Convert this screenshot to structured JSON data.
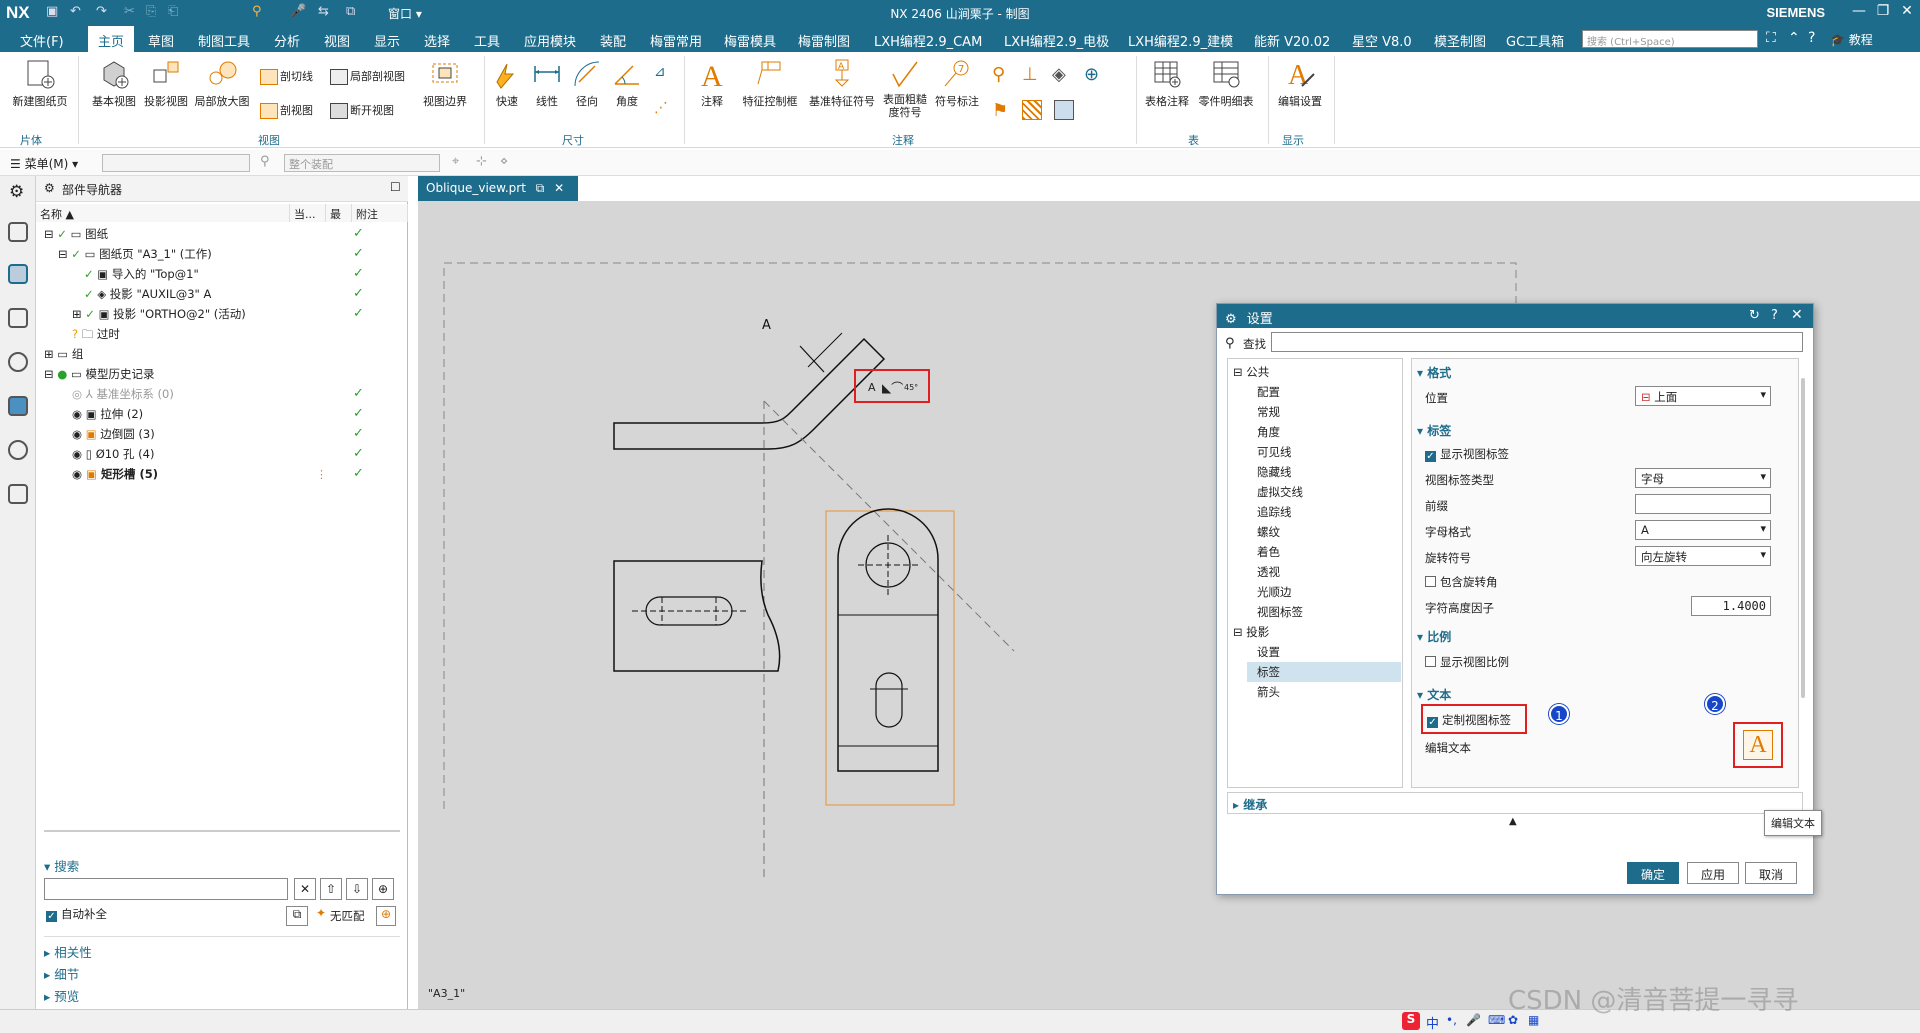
{
  "titlebar": {
    "logo": "NX",
    "title": "NX 2406 山涧栗子 - 制图",
    "window_menu": "窗口",
    "brand": "SIEMENS"
  },
  "menubar": {
    "items": [
      "文件(F)",
      "主页",
      "草图",
      "制图工具",
      "分析",
      "视图",
      "显示",
      "选择",
      "工具",
      "应用模块",
      "装配",
      "梅雷常用",
      "梅雷模具",
      "梅雷制图",
      "LXH编程2.9_CAM",
      "LXH编程2.9_电极",
      "LXH编程2.9_建模",
      "能新 V20.02",
      "星空 V8.0",
      "模圣制图",
      "GC工具箱"
    ],
    "search_placeholder": "搜索 (Ctrl+Space)",
    "tutorial": "教程"
  },
  "ribbon": {
    "sheet_group": {
      "new_sheet": "新建图纸页",
      "label": "片体"
    },
    "view_group": {
      "base_view": "基本视图",
      "projected_view": "投影视图",
      "detail_view": "局部放大图",
      "section_line": "剖切线",
      "section_view": "剖视图",
      "local_section": "局部剖视图",
      "break_view": "断开视图",
      "view_boundary": "视图边界",
      "label": "视图"
    },
    "dim_group": {
      "rapid": "快速",
      "linear": "线性",
      "radial": "径向",
      "angular": "角度",
      "label": "尺寸"
    },
    "annot_group": {
      "note": "注释",
      "fcf": "特征控制框",
      "datum": "基准特征符号",
      "surface_finish": "表面粗糙度符号",
      "symbol_label": "符号标注",
      "label": "注释"
    },
    "table_group": {
      "tabular_note": "表格注释",
      "parts_list": "零件明细表",
      "label": "表"
    },
    "display_group": {
      "edit_settings": "编辑设置",
      "label": "显示"
    }
  },
  "toolbar2": {
    "menu": "菜单(M)",
    "assembly_filter": "整个装配"
  },
  "navigator": {
    "title": "部件导航器",
    "columns": [
      "名称",
      "当...",
      "最",
      "附注"
    ],
    "rows": [
      {
        "label": "图纸",
        "indent": 0
      },
      {
        "label": "图纸页 \"A3_1\" (工作)",
        "indent": 1
      },
      {
        "label": "导入的 \"Top@1\"",
        "indent": 2
      },
      {
        "label": "投影 \"AUXIL@3\" A",
        "indent": 2
      },
      {
        "label": "投影 \"ORTHO@2\" (活动)",
        "indent": 2
      },
      {
        "label": "过时",
        "indent": 1
      },
      {
        "label": "组",
        "indent": 0
      },
      {
        "label": "模型历史记录",
        "indent": 0
      },
      {
        "label": "基准坐标系 (0)",
        "indent": 1
      },
      {
        "label": "拉伸 (2)",
        "indent": 1
      },
      {
        "label": "边倒圆 (3)",
        "indent": 1
      },
      {
        "label": "Ø10 孔 (4)",
        "indent": 1
      },
      {
        "label": "矩形槽 (5)",
        "indent": 1
      }
    ],
    "search_section": "搜索",
    "autocomplete": "自动补全",
    "no_match": "无匹配",
    "sections": [
      "相关性",
      "细节",
      "预览"
    ]
  },
  "canvas": {
    "doc_tab": "Oblique_view.prt",
    "sheet_name": "\"A3_1\"",
    "view_letter": "A",
    "label_text": "A",
    "rotation_angle": "45°"
  },
  "dialog": {
    "title": "设置",
    "find_label": "查找",
    "tree": {
      "public": "公共",
      "public_items": [
        "配置",
        "常规",
        "角度",
        "可见线",
        "隐藏线",
        "虚拟交线",
        "追踪线",
        "螺纹",
        "着色",
        "透视",
        "光顺边",
        "视图标签"
      ],
      "projection": "投影",
      "projection_items": [
        "设置",
        "标签",
        "箭头"
      ]
    },
    "format": {
      "title": "格式",
      "position_label": "位置",
      "position_value": "上面"
    },
    "label": {
      "title": "标签",
      "show_view_label": "显示视图标签",
      "label_type_label": "视图标签类型",
      "label_type_value": "字母",
      "prefix_label": "前缀",
      "letter_format_label": "字母格式",
      "letter_format_value": "A",
      "rotation_symbol_label": "旋转符号",
      "rotation_symbol_value": "向左旋转",
      "include_angle": "包含旋转角",
      "char_height_label": "字符高度因子",
      "char_height_value": "1.4000"
    },
    "scale": {
      "title": "比例",
      "show_scale": "显示视图比例"
    },
    "text": {
      "title": "文本",
      "custom_label": "定制视图标签",
      "edit_text": "编辑文本"
    },
    "inherit": "继承",
    "buttons": {
      "ok": "确定",
      "apply": "应用",
      "cancel": "取消"
    },
    "tooltip": "编辑文本",
    "badges": [
      "1",
      "2"
    ]
  },
  "statusbar": {
    "ime": "中",
    "watermark": "CSDN @清音菩提一寻寻"
  },
  "colors": {
    "accent": "#1e6c8c",
    "callout": "#e02020",
    "badge": "#1747c8",
    "check": "#2ca02c"
  }
}
